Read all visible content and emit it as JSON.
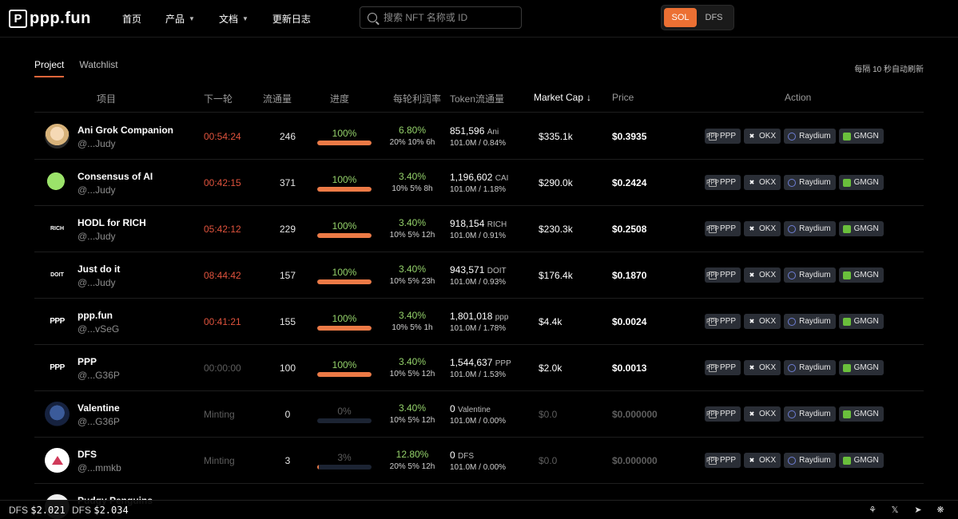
{
  "header": {
    "logo_mark": "P",
    "logo_text": "ppp.fun",
    "nav": [
      {
        "label": "首页",
        "dropdown": false
      },
      {
        "label": "产品",
        "dropdown": true
      },
      {
        "label": "文档",
        "dropdown": true
      },
      {
        "label": "更新日志",
        "dropdown": false
      }
    ],
    "search_placeholder": "搜索 NFT 名称或 ID",
    "toggle": {
      "active": "SOL",
      "inactive": "DFS"
    },
    "accent_color": "#ec7033"
  },
  "tabs": [
    {
      "label": "Project",
      "active": true
    },
    {
      "label": "Watchlist",
      "active": false
    }
  ],
  "refresh_note": "每隔 10 秒自动刷新",
  "columns": {
    "project": "项目",
    "next_round": "下一轮",
    "circulation": "流通量",
    "progress": "进度",
    "yield": "每轮利润率",
    "token_circulation": "Token流通量",
    "market_cap": "Market Cap",
    "price": "Price",
    "action": "Action"
  },
  "action_buttons": [
    "PPP",
    "OKX",
    "Raydium",
    "GMGN"
  ],
  "rows": [
    {
      "name": "Ani Grok Companion",
      "owner": "@...Judy",
      "avatar": "ani",
      "avatar_text": "",
      "timer": "00:54:24",
      "timer_active": true,
      "circulation": "246",
      "progress_label": "100%",
      "progress": 1.0,
      "yield_rate": "6.80%",
      "yield_sub": "20% 10% 6h",
      "token_amount": "851,596",
      "token_symbol": "Ani",
      "token_sub": "101.0M / 0.84%",
      "market_cap": "$335.1k",
      "price": "$0.3935",
      "live": true
    },
    {
      "name": "Consensus of AI",
      "owner": "@...Judy",
      "avatar": "cai",
      "avatar_text": "",
      "timer": "00:42:15",
      "timer_active": true,
      "circulation": "371",
      "progress_label": "100%",
      "progress": 1.0,
      "yield_rate": "3.40%",
      "yield_sub": "10% 5% 8h",
      "token_amount": "1,196,602",
      "token_symbol": "CAI",
      "token_sub": "101.0M / 1.18%",
      "market_cap": "$290.0k",
      "price": "$0.2424",
      "live": true
    },
    {
      "name": "HODL for RICH",
      "owner": "@...Judy",
      "avatar": "text",
      "avatar_text": "RICH",
      "timer": "05:42:12",
      "timer_active": true,
      "circulation": "229",
      "progress_label": "100%",
      "progress": 1.0,
      "yield_rate": "3.40%",
      "yield_sub": "10% 5% 12h",
      "token_amount": "918,154",
      "token_symbol": "RICH",
      "token_sub": "101.0M / 0.91%",
      "market_cap": "$230.3k",
      "price": "$0.2508",
      "live": true
    },
    {
      "name": "Just do it",
      "owner": "@...Judy",
      "avatar": "text",
      "avatar_text": "DOIT",
      "timer": "08:44:42",
      "timer_active": true,
      "circulation": "157",
      "progress_label": "100%",
      "progress": 1.0,
      "yield_rate": "3.40%",
      "yield_sub": "10% 5% 23h",
      "token_amount": "943,571",
      "token_symbol": "DOIT",
      "token_sub": "101.0M / 0.93%",
      "market_cap": "$176.4k",
      "price": "$0.1870",
      "live": true
    },
    {
      "name": "ppp.fun",
      "owner": "@...vSeG",
      "avatar": "ppp",
      "avatar_text": "PPP",
      "timer": "00:41:21",
      "timer_active": true,
      "circulation": "155",
      "progress_label": "100%",
      "progress": 1.0,
      "yield_rate": "3.40%",
      "yield_sub": "10% 5% 1h",
      "token_amount": "1,801,018",
      "token_symbol": "ppp",
      "token_sub": "101.0M / 1.78%",
      "market_cap": "$4.4k",
      "price": "$0.0024",
      "live": true
    },
    {
      "name": "PPP",
      "owner": "@...G36P",
      "avatar": "ppp",
      "avatar_text": "PPP",
      "timer": "00:00:00",
      "timer_active": false,
      "circulation": "100",
      "progress_label": "100%",
      "progress": 1.0,
      "yield_rate": "3.40%",
      "yield_sub": "10% 5% 12h",
      "token_amount": "1,544,637",
      "token_symbol": "PPP",
      "token_sub": "101.0M / 1.53%",
      "market_cap": "$2.0k",
      "price": "$0.0013",
      "live": true
    },
    {
      "name": "Valentine",
      "owner": "@...G36P",
      "avatar": "val",
      "avatar_text": "",
      "timer": "Minting",
      "timer_active": false,
      "circulation": "0",
      "progress_label": "0%",
      "progress": 0.0,
      "yield_rate": "3.40%",
      "yield_sub": "10% 5% 12h",
      "token_amount": "0",
      "token_symbol": "Valentine",
      "token_sub": "101.0M / 0.00%",
      "market_cap": "$0.0",
      "price": "$0.000000",
      "live": false
    },
    {
      "name": "DFS",
      "owner": "@...mmkb",
      "avatar": "dfs",
      "avatar_text": "",
      "timer": "Minting",
      "timer_active": false,
      "circulation": "3",
      "progress_label": "3%",
      "progress": 0.03,
      "yield_rate": "12.80%",
      "yield_sub": "20% 5% 12h",
      "token_amount": "0",
      "token_symbol": "DFS",
      "token_sub": "101.0M / 0.00%",
      "market_cap": "$0.0",
      "price": "$0.000000",
      "live": false
    }
  ],
  "partial_row_name": "Pudgy Penguins",
  "footer": {
    "tickers": [
      {
        "symbol": "DFS",
        "value": "$2.021"
      },
      {
        "symbol": "DFS",
        "value": "$2.034"
      }
    ],
    "icons": [
      "link-icon",
      "x-icon",
      "telegram-icon",
      "settings-icon"
    ]
  }
}
